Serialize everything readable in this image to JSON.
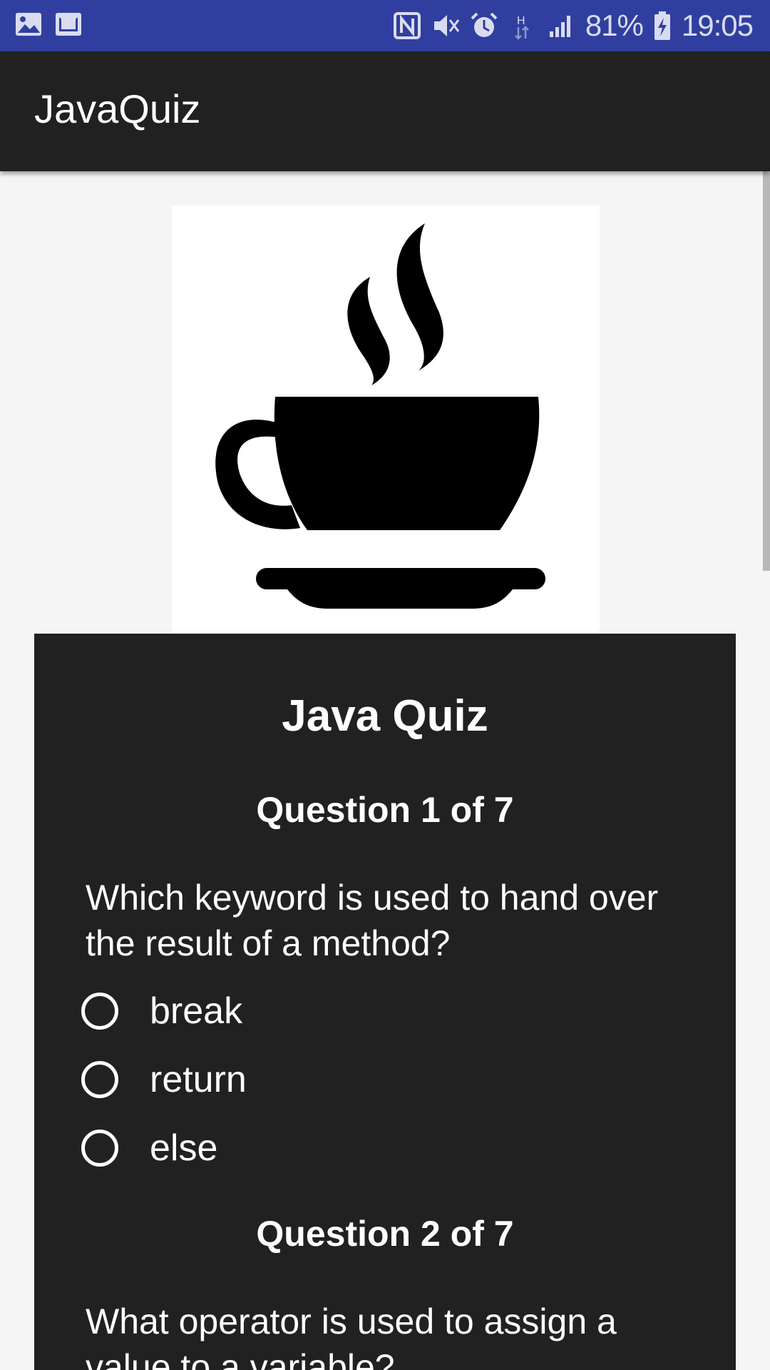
{
  "status_bar": {
    "left_icons": [
      "gallery-icon",
      "mail-icon"
    ],
    "right_icons": [
      "nfc-icon",
      "mute-icon",
      "alarm-icon",
      "hspa-icon",
      "signal-icon"
    ],
    "battery_percent": "81%",
    "time": "19:05",
    "background": "#303f9f"
  },
  "app_bar": {
    "title": "JavaQuiz",
    "background": "#212121"
  },
  "logo": {
    "icon": "coffee-cup-icon"
  },
  "quiz": {
    "title": "Java Quiz",
    "questions": [
      {
        "number_label": "Question 1 of 7",
        "text": "Which keyword is used to hand over the result of a method?",
        "options": [
          "break",
          "return",
          "else"
        ]
      },
      {
        "number_label": "Question 2 of 7",
        "text": "What operator is used to assign a value to a variable?"
      }
    ]
  }
}
